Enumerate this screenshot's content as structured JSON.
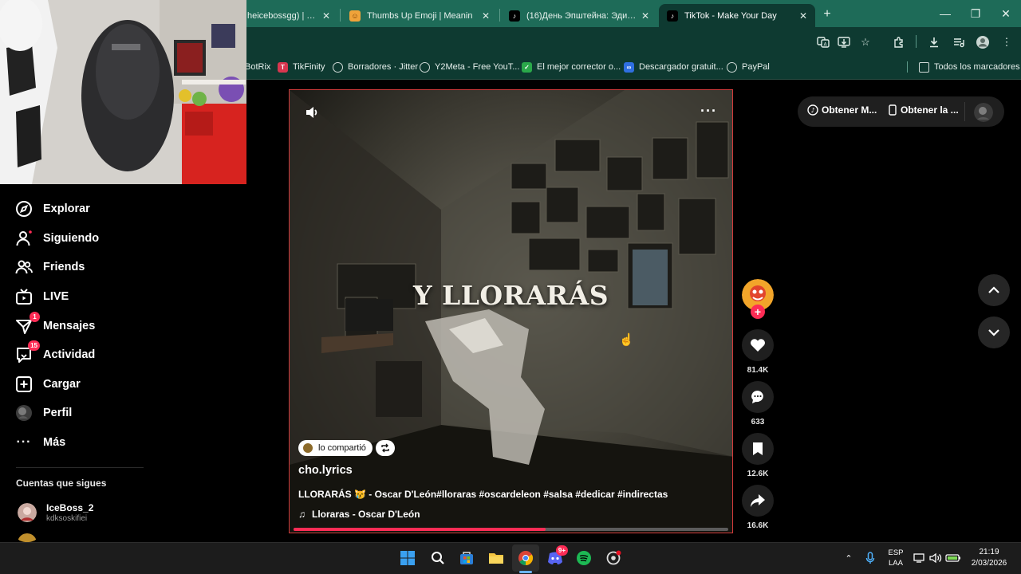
{
  "browser": {
    "tabs": [
      {
        "title": "heicebossgg) | TikT",
        "icon": "tiktok-icon"
      },
      {
        "title": "Thumbs Up Emoji | Meanin",
        "icon": "emojipedia-icon"
      },
      {
        "title": "(16)День Эпштейна: Эдит и Ог",
        "icon": "tiktok-icon"
      },
      {
        "title": "TikTok - Make Your Day",
        "icon": "tiktok-icon",
        "active": true
      }
    ],
    "bookmarks": [
      {
        "label": "BotRix"
      },
      {
        "label": "TikFinity"
      },
      {
        "label": "Borradores · Jitter"
      },
      {
        "label": "Y2Meta - Free YouT..."
      },
      {
        "label": "El mejor corrector o..."
      },
      {
        "label": "Descargador gratuit..."
      },
      {
        "label": "PayPal"
      }
    ],
    "all_bookmarks": "Todos los marcadores"
  },
  "sidebar": {
    "items": [
      {
        "label": "Explorar"
      },
      {
        "label": "Siguiendo"
      },
      {
        "label": "Friends"
      },
      {
        "label": "LIVE"
      },
      {
        "label": "Mensajes",
        "badge": "1"
      },
      {
        "label": "Actividad",
        "badge": "15"
      },
      {
        "label": "Cargar"
      },
      {
        "label": "Perfil"
      },
      {
        "label": "Más"
      }
    ],
    "following_title": "Cuentas que sigues",
    "following": [
      {
        "name": "IceBoss_2",
        "handle": "kdksoskifiei"
      }
    ]
  },
  "topbar": {
    "get_m": "Obtener M...",
    "get_app": "Obtener la ..."
  },
  "video": {
    "caption_text": "Y LLORARÁS",
    "shared_label": "lo compartió",
    "author": "cho.lyrics",
    "description": "LLORARÁS 😿 - Oscar D'León#lloraras #oscardeleon #salsa #dedicar #indirectas",
    "music": "Lloraras - Oscar D'León",
    "progress": 0.58
  },
  "actions": {
    "likes": "81.4K",
    "comments": "633",
    "saves": "12.6K",
    "shares": "16.6K"
  },
  "taskbar": {
    "lang_top": "ESP",
    "lang_bottom": "LAA",
    "time": "21:19",
    "date": "2/03/2026",
    "chat_badge": "9+"
  }
}
